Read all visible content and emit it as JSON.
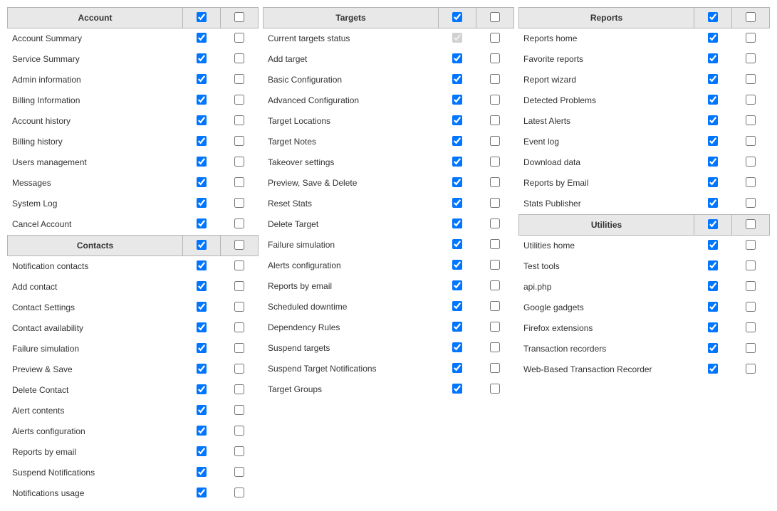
{
  "columns": [
    {
      "sections": [
        {
          "title": "Account",
          "header_c1": true,
          "header_c2": false,
          "rows": [
            {
              "label": "Account Summary",
              "c1": true,
              "c2": false
            },
            {
              "label": "Service Summary",
              "c1": true,
              "c2": false
            },
            {
              "label": "Admin information",
              "c1": true,
              "c2": false
            },
            {
              "label": "Billing Information",
              "c1": true,
              "c2": false
            },
            {
              "label": "Account history",
              "c1": true,
              "c2": false
            },
            {
              "label": "Billing history",
              "c1": true,
              "c2": false
            },
            {
              "label": "Users management",
              "c1": true,
              "c2": false
            },
            {
              "label": "Messages",
              "c1": true,
              "c2": false
            },
            {
              "label": "System Log",
              "c1": true,
              "c2": false
            },
            {
              "label": "Cancel Account",
              "c1": true,
              "c2": false
            }
          ]
        },
        {
          "title": "Contacts",
          "header_c1": true,
          "header_c2": false,
          "rows": [
            {
              "label": "Notification contacts",
              "c1": true,
              "c2": false
            },
            {
              "label": "Add contact",
              "c1": true,
              "c2": false
            },
            {
              "label": "Contact Settings",
              "c1": true,
              "c2": false
            },
            {
              "label": "Contact availability",
              "c1": true,
              "c2": false
            },
            {
              "label": "Failure simulation",
              "c1": true,
              "c2": false
            },
            {
              "label": "Preview & Save",
              "c1": true,
              "c2": false
            },
            {
              "label": "Delete Contact",
              "c1": true,
              "c2": false
            },
            {
              "label": "Alert contents",
              "c1": true,
              "c2": false
            },
            {
              "label": "Alerts configuration",
              "c1": true,
              "c2": false
            },
            {
              "label": "Reports by email",
              "c1": true,
              "c2": false
            },
            {
              "label": "Suspend Notifications",
              "c1": true,
              "c2": false
            },
            {
              "label": "Notifications usage",
              "c1": true,
              "c2": false
            }
          ]
        }
      ]
    },
    {
      "sections": [
        {
          "title": "Targets",
          "header_c1": true,
          "header_c2": false,
          "rows": [
            {
              "label": "Current targets status",
              "c1": true,
              "c2": false,
              "disabled": true
            },
            {
              "label": "Add target",
              "c1": true,
              "c2": false
            },
            {
              "label": "Basic Configuration",
              "c1": true,
              "c2": false
            },
            {
              "label": "Advanced Configuration",
              "c1": true,
              "c2": false
            },
            {
              "label": "Target Locations",
              "c1": true,
              "c2": false
            },
            {
              "label": "Target Notes",
              "c1": true,
              "c2": false
            },
            {
              "label": "Takeover settings",
              "c1": true,
              "c2": false
            },
            {
              "label": "Preview, Save & Delete",
              "c1": true,
              "c2": false
            },
            {
              "label": "Reset Stats",
              "c1": true,
              "c2": false
            },
            {
              "label": "Delete Target",
              "c1": true,
              "c2": false
            },
            {
              "label": "Failure simulation",
              "c1": true,
              "c2": false
            },
            {
              "label": "Alerts configuration",
              "c1": true,
              "c2": false
            },
            {
              "label": "Reports by email",
              "c1": true,
              "c2": false
            },
            {
              "label": "Scheduled downtime",
              "c1": true,
              "c2": false
            },
            {
              "label": "Dependency Rules",
              "c1": true,
              "c2": false
            },
            {
              "label": "Suspend targets",
              "c1": true,
              "c2": false
            },
            {
              "label": "Suspend Target Notifications",
              "c1": true,
              "c2": false
            },
            {
              "label": "Target Groups",
              "c1": true,
              "c2": false
            }
          ]
        }
      ]
    },
    {
      "sections": [
        {
          "title": "Reports",
          "header_c1": true,
          "header_c2": false,
          "rows": [
            {
              "label": "Reports home",
              "c1": true,
              "c2": false
            },
            {
              "label": "Favorite reports",
              "c1": true,
              "c2": false
            },
            {
              "label": "Report wizard",
              "c1": true,
              "c2": false
            },
            {
              "label": "Detected Problems",
              "c1": true,
              "c2": false
            },
            {
              "label": "Latest Alerts",
              "c1": true,
              "c2": false
            },
            {
              "label": "Event log",
              "c1": true,
              "c2": false
            },
            {
              "label": "Download data",
              "c1": true,
              "c2": false
            },
            {
              "label": "Reports by Email",
              "c1": true,
              "c2": false
            },
            {
              "label": "Stats Publisher",
              "c1": true,
              "c2": false
            }
          ]
        },
        {
          "title": "Utilities",
          "header_c1": true,
          "header_c2": false,
          "rows": [
            {
              "label": "Utilities home",
              "c1": true,
              "c2": false
            },
            {
              "label": "Test tools",
              "c1": true,
              "c2": false
            },
            {
              "label": "api.php",
              "c1": true,
              "c2": false
            },
            {
              "label": "Google gadgets",
              "c1": true,
              "c2": false
            },
            {
              "label": "Firefox extensions",
              "c1": true,
              "c2": false
            },
            {
              "label": "Transaction recorders",
              "c1": true,
              "c2": false
            },
            {
              "label": "Web-Based Transaction Recorder",
              "c1": true,
              "c2": false
            }
          ]
        }
      ]
    }
  ]
}
